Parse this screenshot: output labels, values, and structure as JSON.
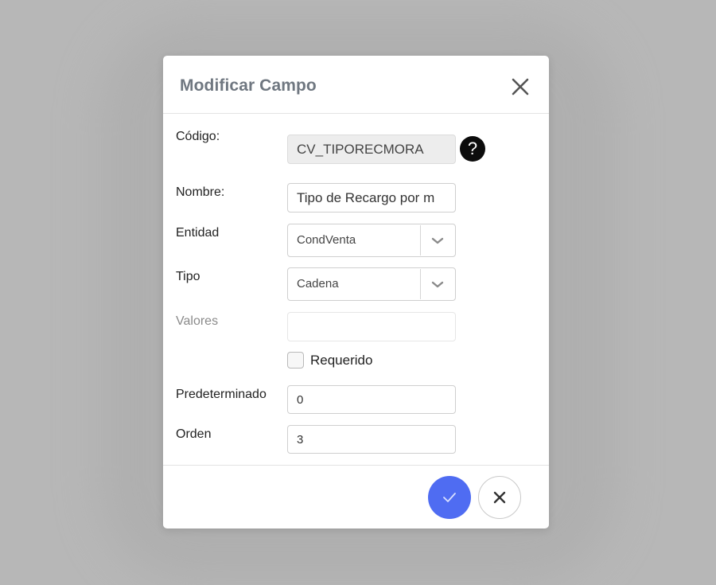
{
  "modal": {
    "title": "Modificar Campo"
  },
  "form": {
    "codigo": {
      "label": "Código:",
      "value": "CV_TIPORECMORA"
    },
    "nombre": {
      "label": "Nombre:",
      "value": "Tipo de Recargo por m"
    },
    "entidad": {
      "label": "Entidad",
      "value": "CondVenta"
    },
    "tipo": {
      "label": "Tipo",
      "value": "Cadena"
    },
    "valores": {
      "label": "Valores",
      "value": ""
    },
    "requerido": {
      "label": "Requerido",
      "checked": false
    },
    "predeterminado": {
      "label": "Predeterminado",
      "value": "0"
    },
    "orden": {
      "label": "Orden",
      "value": "3"
    }
  },
  "help": {
    "symbol": "?"
  },
  "colors": {
    "accent": "#4f6cf2",
    "backdrop": "#b7b7b7",
    "title": "#6f7780"
  },
  "icons": {
    "close": "close-icon",
    "help": "help-icon",
    "chevron": "chevron-down-icon",
    "confirm": "check-icon",
    "cancel": "close-icon"
  }
}
